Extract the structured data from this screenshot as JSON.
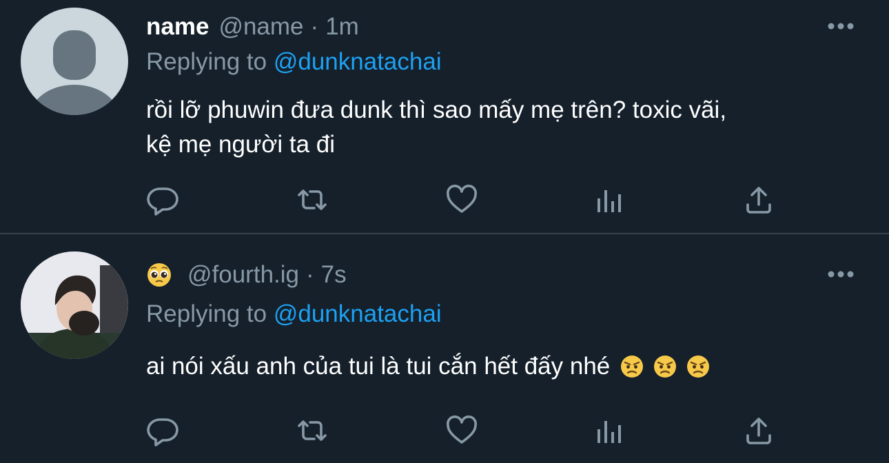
{
  "colors": {
    "background": "#15202b",
    "secondary_text": "#8899a6",
    "mention": "#1da1f2",
    "divider": "#38444d"
  },
  "tweets": [
    {
      "display_name": "name",
      "handle": "@name",
      "separator": "·",
      "time": "1m",
      "replying_label": "Replying to",
      "replying_to": "@dunknatachai",
      "text_line1": "rồi lỡ phuwin đưa dunk thì sao mấy mẹ trên? toxic vãi,",
      "text_line2": "kệ mẹ người ta đi",
      "avatar": "default-profile-avatar"
    },
    {
      "display_name_emoji": "pleading-face-emoji",
      "handle": "@fourth.ig",
      "separator": "·",
      "time": "7s",
      "replying_label": "Replying to",
      "replying_to": "@dunknatachai",
      "text": "ai nói xấu anh của tui là tui cắn hết đấy nhé",
      "text_emojis": [
        "angry-face-emoji",
        "angry-face-emoji",
        "angry-face-emoji"
      ],
      "avatar": "user-photo-avatar"
    }
  ],
  "actions": [
    "reply-icon",
    "retweet-icon",
    "like-icon",
    "analytics-icon",
    "share-icon"
  ]
}
